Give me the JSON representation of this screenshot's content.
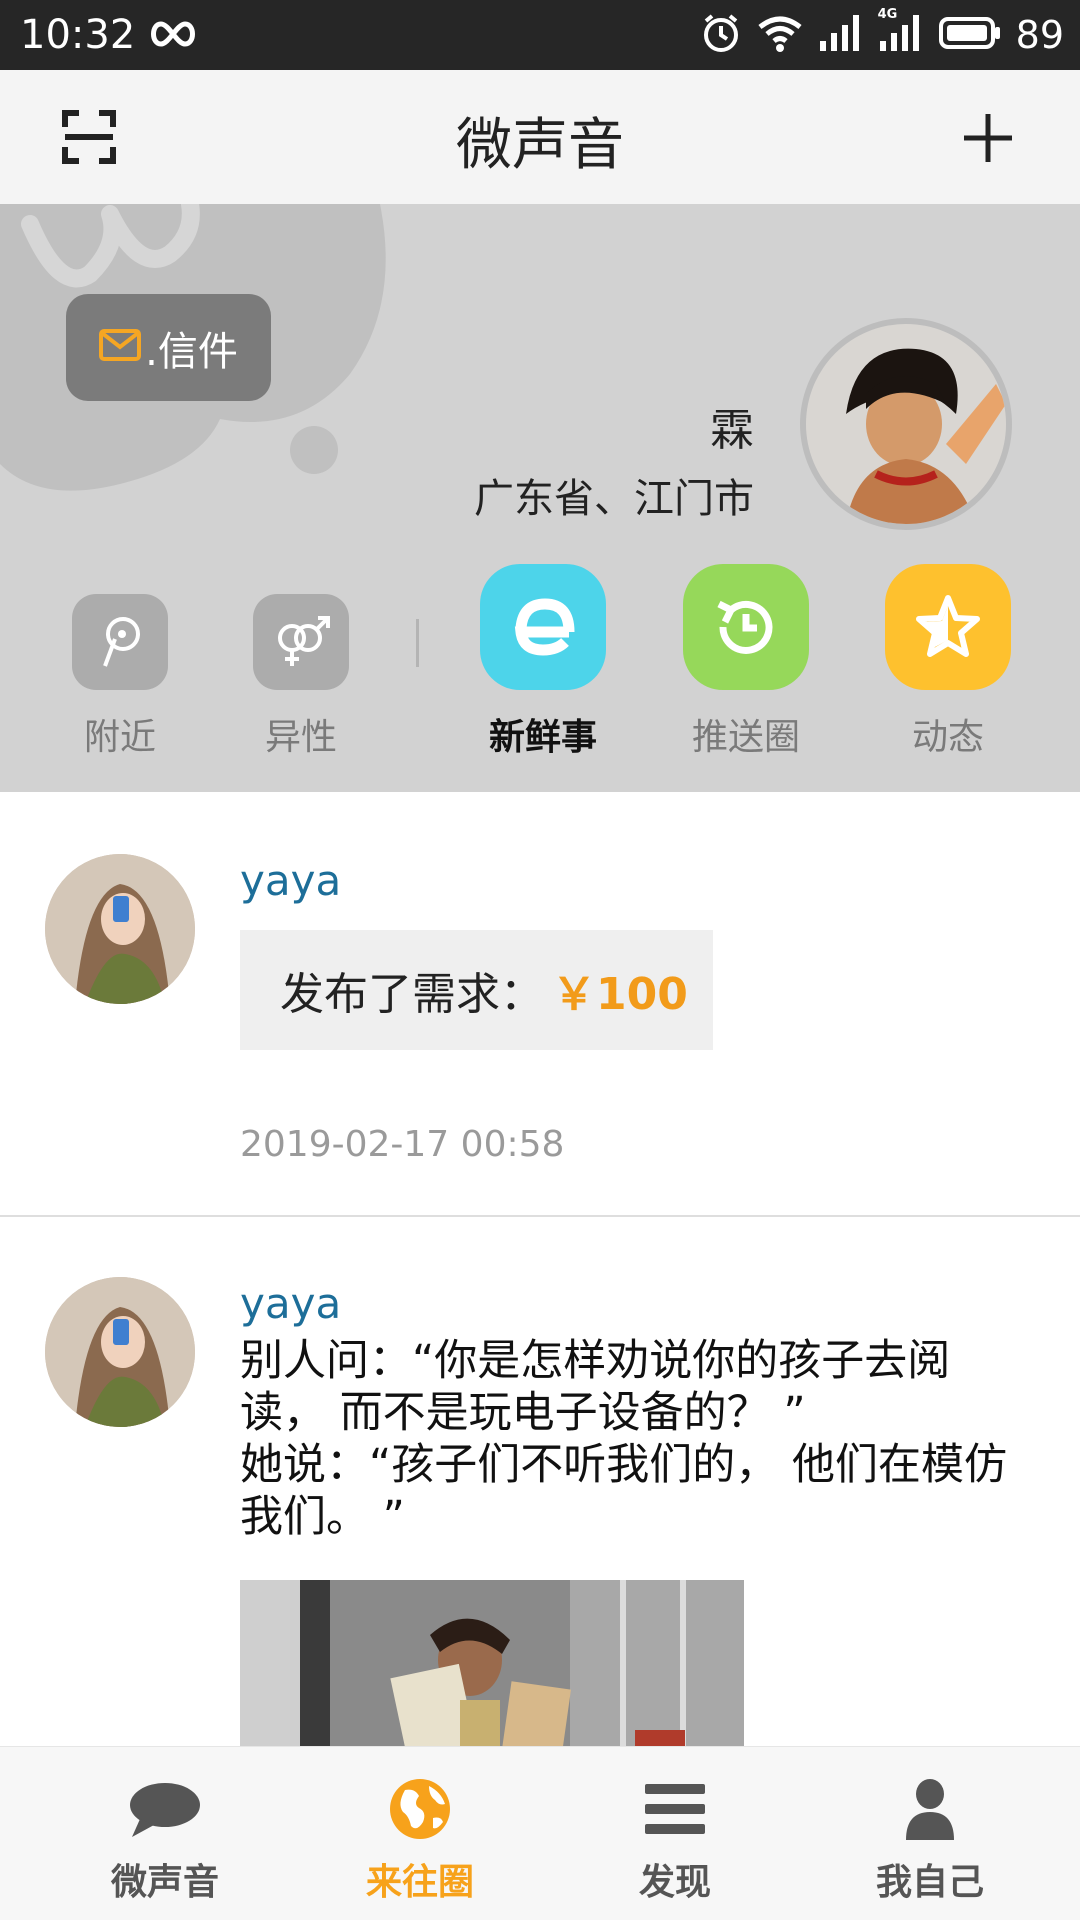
{
  "status_bar": {
    "time": "10:32",
    "network_type": "4G",
    "battery": "89"
  },
  "header": {
    "title": "微声音",
    "left_icon": "scan-icon",
    "right_icon": "plus-icon"
  },
  "banner": {
    "mail_label": ".信件",
    "name": "霖",
    "location": "广东省、江门市"
  },
  "shortcuts": [
    {
      "label": "附近",
      "icon": "nearby-icon"
    },
    {
      "label": "异性",
      "icon": "gender-icon"
    },
    {
      "label": "新鲜事",
      "icon": "news-icon",
      "active": true,
      "color": "#4dd4ea"
    },
    {
      "label": "推送圈",
      "icon": "push-icon",
      "color": "#96d85a"
    },
    {
      "label": "动态",
      "icon": "star-icon",
      "color": "#fec12e"
    }
  ],
  "posts": [
    {
      "user": "yaya",
      "request_label": "发布了需求：",
      "amount": "￥100",
      "time": "2019-02-17 00:58"
    },
    {
      "user": "yaya",
      "text_line1": "别人问：“你是怎样劝说你的孩子去阅",
      "text_line2": "读， 而不是玩电子设备的？ ”",
      "text_line3": "她说：“孩子们不听我们的， 他们在模仿",
      "text_line4": "我们。 ”"
    }
  ],
  "bottom_nav": [
    {
      "label": "微声音",
      "icon": "chat-icon"
    },
    {
      "label": "来往圈",
      "icon": "globe-icon",
      "active": true
    },
    {
      "label": "发现",
      "icon": "menu-icon"
    },
    {
      "label": "我自己",
      "icon": "person-icon"
    }
  ],
  "colors": {
    "accent": "#f7a21b",
    "username": "#1d6e99",
    "banner_bg": "#d2d2d2"
  }
}
